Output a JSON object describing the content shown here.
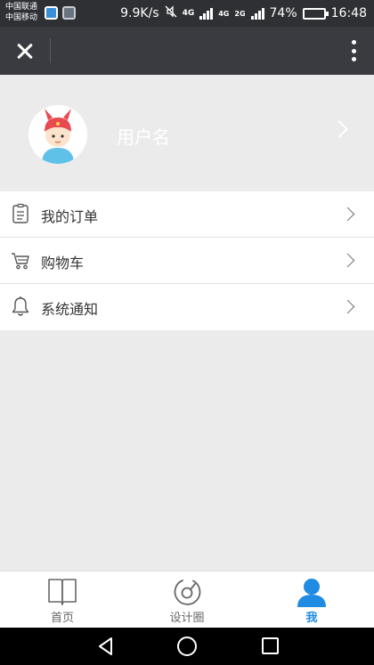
{
  "status_bar": {
    "carrier_1": "中国联通",
    "carrier_2": "中国移动",
    "net_speed": "9.9K/s",
    "network_1": "4G",
    "network_2": "4G",
    "network_3": "2G",
    "battery": "74%",
    "battery_level": 0.74,
    "time": "16:48"
  },
  "title_bar": {
    "close_icon": "close-icon",
    "more_icon": "more-vertical-icon",
    "background": "#393b40"
  },
  "profile": {
    "username": "用户名",
    "avatar_icon": "cartoon-avatar-icon",
    "background": "#ebebeb"
  },
  "menu": {
    "items": [
      {
        "label": "我的订单",
        "icon": "order-list-icon"
      },
      {
        "label": "购物车",
        "icon": "shopping-cart-icon"
      },
      {
        "label": "系统通知",
        "icon": "bell-icon"
      }
    ]
  },
  "tab_bar": {
    "tabs": [
      {
        "label": "首页",
        "icon": "book-icon",
        "active": false
      },
      {
        "label": "设计圈",
        "icon": "design-circle-icon",
        "active": false
      },
      {
        "label": "我",
        "icon": "person-icon",
        "active": true
      }
    ],
    "active_color": "#1f8be3"
  }
}
